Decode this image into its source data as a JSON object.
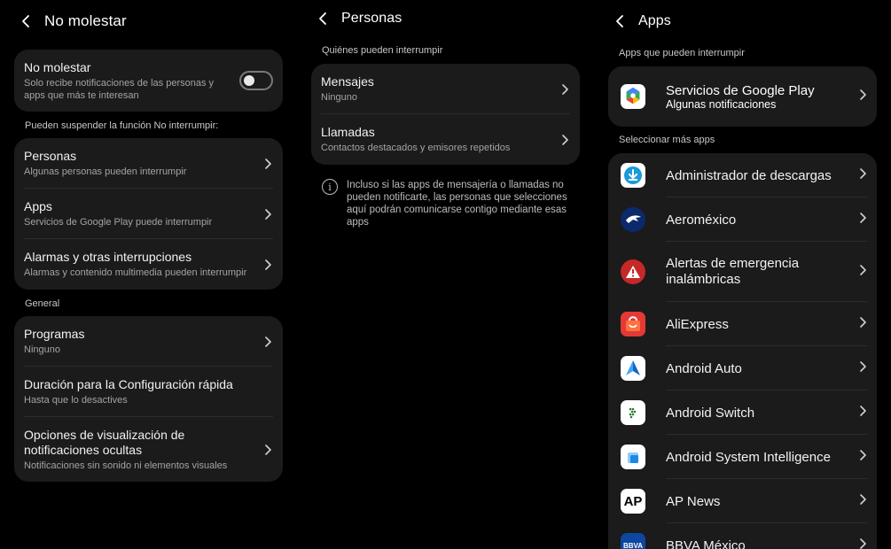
{
  "panel1": {
    "title": "No molestar",
    "main_toggle": {
      "title": "No molestar",
      "subtitle": "Solo recibe notificaciones de las personas y apps que más te interesan",
      "on": false
    },
    "section_suspend": "Pueden suspender la función No interrumpir:",
    "suspend_items": [
      {
        "title": "Personas",
        "subtitle": "Algunas personas pueden interrumpir"
      },
      {
        "title": "Apps",
        "subtitle": "Servicios de Google Play puede interrumpir"
      },
      {
        "title": "Alarmas y otras interrupciones",
        "subtitle": "Alarmas y contenido multimedia pueden interrumpir"
      }
    ],
    "section_general": "General",
    "general_items": [
      {
        "title": "Programas",
        "subtitle": "Ninguno"
      },
      {
        "title": "Duración para la Configuración rápida",
        "subtitle": "Hasta que lo desactives"
      },
      {
        "title": "Opciones de visualización de notificaciones ocultas",
        "subtitle": "Notificaciones sin sonido ni elementos visuales"
      }
    ]
  },
  "panel2": {
    "title": "Personas",
    "section": "Quiénes pueden interrumpir",
    "items": [
      {
        "title": "Mensajes",
        "subtitle": "Ninguno"
      },
      {
        "title": "Llamadas",
        "subtitle": "Contactos destacados y emisores repetidos"
      }
    ],
    "info_icon": "i",
    "info_text": "Incluso si las apps de mensajería o llamadas no pueden notificarte, las personas que selecciones aquí podrán comunicarse contigo mediante esas apps"
  },
  "panel3": {
    "title": "Apps",
    "section_allowed": "Apps que pueden interrumpir",
    "allowed": [
      {
        "title": "Servicios de Google Play",
        "subtitle": "Algunas notificaciones",
        "icon": "google-play-services-icon"
      }
    ],
    "section_more": "Seleccionar más apps",
    "apps": [
      {
        "name": "Administrador de descargas",
        "icon": "download-manager-icon"
      },
      {
        "name": "Aeroméxico",
        "icon": "aeromexico-icon"
      },
      {
        "name": "Alertas de emergencia inalámbricas",
        "icon": "emergency-alert-icon"
      },
      {
        "name": "AliExpress",
        "icon": "aliexpress-icon"
      },
      {
        "name": "Android Auto",
        "icon": "android-auto-icon"
      },
      {
        "name": "Android Switch",
        "icon": "android-switch-icon"
      },
      {
        "name": "Android System Intelligence",
        "icon": "android-system-intelligence-icon"
      },
      {
        "name": "AP News",
        "icon": "ap-news-icon"
      },
      {
        "name": "BBVA México",
        "icon": "bbva-icon"
      }
    ],
    "icon_labels": {
      "ap": "AP",
      "bbva": "BBVA"
    }
  }
}
